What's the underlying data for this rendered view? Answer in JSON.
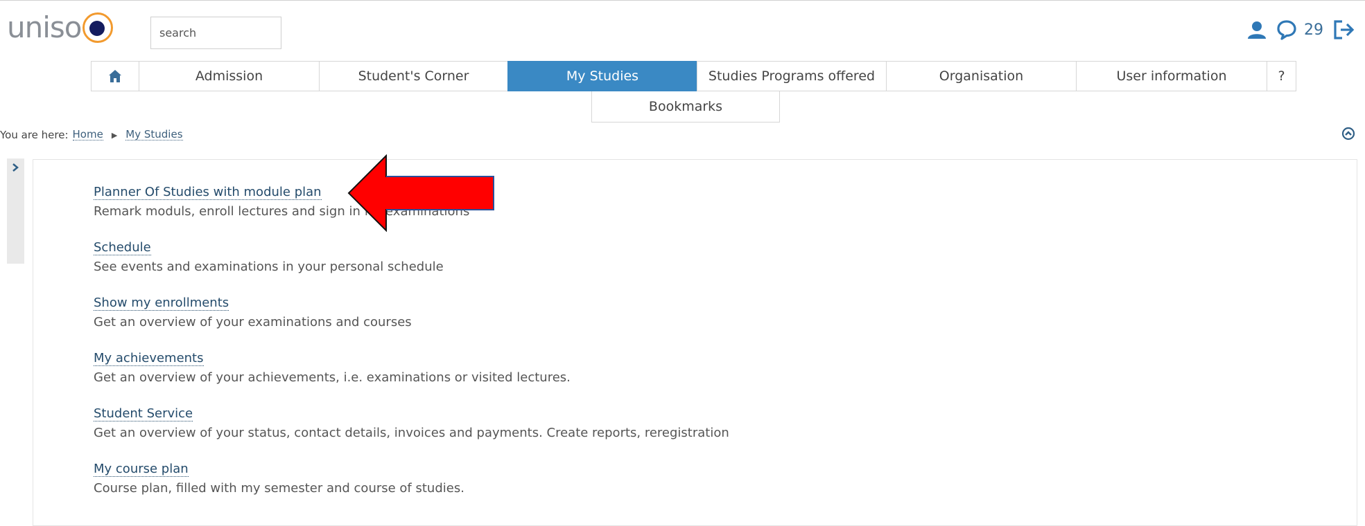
{
  "header": {
    "logo_text": "uniso",
    "search_placeholder": "search",
    "message_count": "29"
  },
  "nav": {
    "tabs": [
      {
        "label": "Admission",
        "active": false
      },
      {
        "label": "Student's Corner",
        "active": false
      },
      {
        "label": "My Studies",
        "active": true
      },
      {
        "label": "Studies Programs offered",
        "active": false
      },
      {
        "label": "Organisation",
        "active": false
      },
      {
        "label": "User information",
        "active": false
      },
      {
        "label": "?",
        "active": false
      }
    ],
    "sub_tab": "Bookmarks"
  },
  "breadcrumb": {
    "prefix": "You are here:",
    "items": [
      "Home",
      "My Studies"
    ]
  },
  "entries": [
    {
      "title": "Planner Of Studies with module plan",
      "description": "Remark moduls, enroll lectures and sign in for examinations"
    },
    {
      "title": "Schedule",
      "description": "See events and examinations in your personal schedule"
    },
    {
      "title": "Show my enrollments",
      "description": "Get an overview of your examinations and courses"
    },
    {
      "title": "My achievements",
      "description": "Get an overview of your achievements, i.e. examinations or visited lectures."
    },
    {
      "title": "Student Service",
      "description": "Get an overview of your status, contact details, invoices and payments. Create reports, reregistration"
    },
    {
      "title": "My course plan",
      "description": "Course plan, filled with my semester and course of studies."
    }
  ],
  "colors": {
    "accent": "#3a89c4",
    "link": "#244b6b",
    "logo_orange": "#f29a2e",
    "logo_navy": "#141c5e",
    "annotation_arrow": "#ff0000"
  },
  "icons": [
    "home-icon",
    "user-icon",
    "chat-icon",
    "logout-icon",
    "chevron-right-icon",
    "collapse-up-icon"
  ]
}
